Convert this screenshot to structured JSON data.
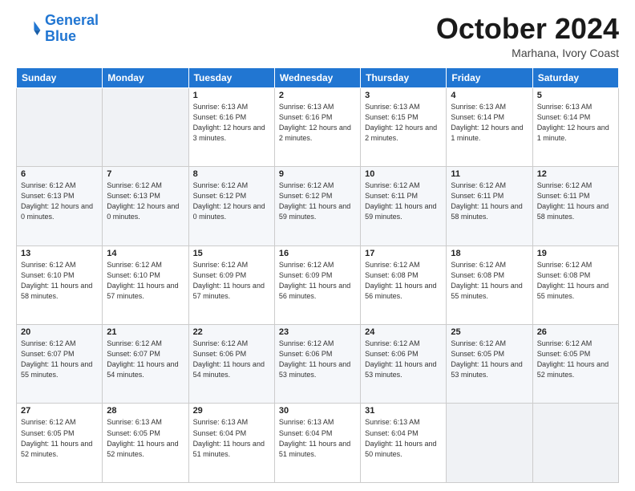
{
  "logo": {
    "line1": "General",
    "line2": "Blue"
  },
  "header": {
    "month": "October 2024",
    "location": "Marhana, Ivory Coast"
  },
  "days_of_week": [
    "Sunday",
    "Monday",
    "Tuesday",
    "Wednesday",
    "Thursday",
    "Friday",
    "Saturday"
  ],
  "weeks": [
    [
      {
        "day": "",
        "sunrise": "",
        "sunset": "",
        "daylight": ""
      },
      {
        "day": "",
        "sunrise": "",
        "sunset": "",
        "daylight": ""
      },
      {
        "day": "1",
        "sunrise": "Sunrise: 6:13 AM",
        "sunset": "Sunset: 6:16 PM",
        "daylight": "Daylight: 12 hours and 3 minutes."
      },
      {
        "day": "2",
        "sunrise": "Sunrise: 6:13 AM",
        "sunset": "Sunset: 6:16 PM",
        "daylight": "Daylight: 12 hours and 2 minutes."
      },
      {
        "day": "3",
        "sunrise": "Sunrise: 6:13 AM",
        "sunset": "Sunset: 6:15 PM",
        "daylight": "Daylight: 12 hours and 2 minutes."
      },
      {
        "day": "4",
        "sunrise": "Sunrise: 6:13 AM",
        "sunset": "Sunset: 6:14 PM",
        "daylight": "Daylight: 12 hours and 1 minute."
      },
      {
        "day": "5",
        "sunrise": "Sunrise: 6:13 AM",
        "sunset": "Sunset: 6:14 PM",
        "daylight": "Daylight: 12 hours and 1 minute."
      }
    ],
    [
      {
        "day": "6",
        "sunrise": "Sunrise: 6:12 AM",
        "sunset": "Sunset: 6:13 PM",
        "daylight": "Daylight: 12 hours and 0 minutes."
      },
      {
        "day": "7",
        "sunrise": "Sunrise: 6:12 AM",
        "sunset": "Sunset: 6:13 PM",
        "daylight": "Daylight: 12 hours and 0 minutes."
      },
      {
        "day": "8",
        "sunrise": "Sunrise: 6:12 AM",
        "sunset": "Sunset: 6:12 PM",
        "daylight": "Daylight: 12 hours and 0 minutes."
      },
      {
        "day": "9",
        "sunrise": "Sunrise: 6:12 AM",
        "sunset": "Sunset: 6:12 PM",
        "daylight": "Daylight: 11 hours and 59 minutes."
      },
      {
        "day": "10",
        "sunrise": "Sunrise: 6:12 AM",
        "sunset": "Sunset: 6:11 PM",
        "daylight": "Daylight: 11 hours and 59 minutes."
      },
      {
        "day": "11",
        "sunrise": "Sunrise: 6:12 AM",
        "sunset": "Sunset: 6:11 PM",
        "daylight": "Daylight: 11 hours and 58 minutes."
      },
      {
        "day": "12",
        "sunrise": "Sunrise: 6:12 AM",
        "sunset": "Sunset: 6:11 PM",
        "daylight": "Daylight: 11 hours and 58 minutes."
      }
    ],
    [
      {
        "day": "13",
        "sunrise": "Sunrise: 6:12 AM",
        "sunset": "Sunset: 6:10 PM",
        "daylight": "Daylight: 11 hours and 58 minutes."
      },
      {
        "day": "14",
        "sunrise": "Sunrise: 6:12 AM",
        "sunset": "Sunset: 6:10 PM",
        "daylight": "Daylight: 11 hours and 57 minutes."
      },
      {
        "day": "15",
        "sunrise": "Sunrise: 6:12 AM",
        "sunset": "Sunset: 6:09 PM",
        "daylight": "Daylight: 11 hours and 57 minutes."
      },
      {
        "day": "16",
        "sunrise": "Sunrise: 6:12 AM",
        "sunset": "Sunset: 6:09 PM",
        "daylight": "Daylight: 11 hours and 56 minutes."
      },
      {
        "day": "17",
        "sunrise": "Sunrise: 6:12 AM",
        "sunset": "Sunset: 6:08 PM",
        "daylight": "Daylight: 11 hours and 56 minutes."
      },
      {
        "day": "18",
        "sunrise": "Sunrise: 6:12 AM",
        "sunset": "Sunset: 6:08 PM",
        "daylight": "Daylight: 11 hours and 55 minutes."
      },
      {
        "day": "19",
        "sunrise": "Sunrise: 6:12 AM",
        "sunset": "Sunset: 6:08 PM",
        "daylight": "Daylight: 11 hours and 55 minutes."
      }
    ],
    [
      {
        "day": "20",
        "sunrise": "Sunrise: 6:12 AM",
        "sunset": "Sunset: 6:07 PM",
        "daylight": "Daylight: 11 hours and 55 minutes."
      },
      {
        "day": "21",
        "sunrise": "Sunrise: 6:12 AM",
        "sunset": "Sunset: 6:07 PM",
        "daylight": "Daylight: 11 hours and 54 minutes."
      },
      {
        "day": "22",
        "sunrise": "Sunrise: 6:12 AM",
        "sunset": "Sunset: 6:06 PM",
        "daylight": "Daylight: 11 hours and 54 minutes."
      },
      {
        "day": "23",
        "sunrise": "Sunrise: 6:12 AM",
        "sunset": "Sunset: 6:06 PM",
        "daylight": "Daylight: 11 hours and 53 minutes."
      },
      {
        "day": "24",
        "sunrise": "Sunrise: 6:12 AM",
        "sunset": "Sunset: 6:06 PM",
        "daylight": "Daylight: 11 hours and 53 minutes."
      },
      {
        "day": "25",
        "sunrise": "Sunrise: 6:12 AM",
        "sunset": "Sunset: 6:05 PM",
        "daylight": "Daylight: 11 hours and 53 minutes."
      },
      {
        "day": "26",
        "sunrise": "Sunrise: 6:12 AM",
        "sunset": "Sunset: 6:05 PM",
        "daylight": "Daylight: 11 hours and 52 minutes."
      }
    ],
    [
      {
        "day": "27",
        "sunrise": "Sunrise: 6:12 AM",
        "sunset": "Sunset: 6:05 PM",
        "daylight": "Daylight: 11 hours and 52 minutes."
      },
      {
        "day": "28",
        "sunrise": "Sunrise: 6:13 AM",
        "sunset": "Sunset: 6:05 PM",
        "daylight": "Daylight: 11 hours and 52 minutes."
      },
      {
        "day": "29",
        "sunrise": "Sunrise: 6:13 AM",
        "sunset": "Sunset: 6:04 PM",
        "daylight": "Daylight: 11 hours and 51 minutes."
      },
      {
        "day": "30",
        "sunrise": "Sunrise: 6:13 AM",
        "sunset": "Sunset: 6:04 PM",
        "daylight": "Daylight: 11 hours and 51 minutes."
      },
      {
        "day": "31",
        "sunrise": "Sunrise: 6:13 AM",
        "sunset": "Sunset: 6:04 PM",
        "daylight": "Daylight: 11 hours and 50 minutes."
      },
      {
        "day": "",
        "sunrise": "",
        "sunset": "",
        "daylight": ""
      },
      {
        "day": "",
        "sunrise": "",
        "sunset": "",
        "daylight": ""
      }
    ]
  ]
}
